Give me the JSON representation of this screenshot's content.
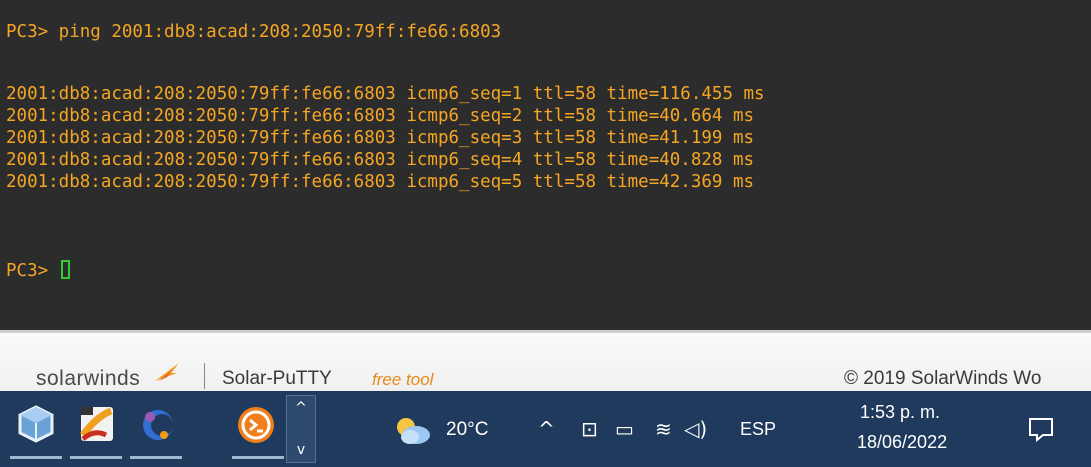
{
  "terminal": {
    "command_line": "PC3> ping 2001:db8:acad:208:2050:79ff:fe66:6803",
    "replies": [
      "2001:db8:acad:208:2050:79ff:fe66:6803 icmp6_seq=1 ttl=58 time=116.455 ms",
      "2001:db8:acad:208:2050:79ff:fe66:6803 icmp6_seq=2 ttl=58 time=40.664 ms",
      "2001:db8:acad:208:2050:79ff:fe66:6803 icmp6_seq=3 ttl=58 time=41.199 ms",
      "2001:db8:acad:208:2050:79ff:fe66:6803 icmp6_seq=4 ttl=58 time=40.828 ms",
      "2001:db8:acad:208:2050:79ff:fe66:6803 icmp6_seq=5 ttl=58 time=42.369 ms"
    ],
    "prompt": "PC3>",
    "text_color": "#f5a623",
    "cursor_color": "#33cc33",
    "background": "#2c2c2c"
  },
  "branding": {
    "logo": "solarwinds",
    "product": "Solar-PuTTY",
    "free_label": "free tool",
    "copyright": "© 2019 SolarWinds Wo"
  },
  "taskbar": {
    "apps": [
      "virtualbox-icon",
      "gns3-icon",
      "eclipse-icon",
      "solar-putty-icon"
    ],
    "weather": "20°C",
    "language": "ESP",
    "time": "1:53 p. m.",
    "date": "18/06/2022",
    "background": "#1f3a5c"
  }
}
